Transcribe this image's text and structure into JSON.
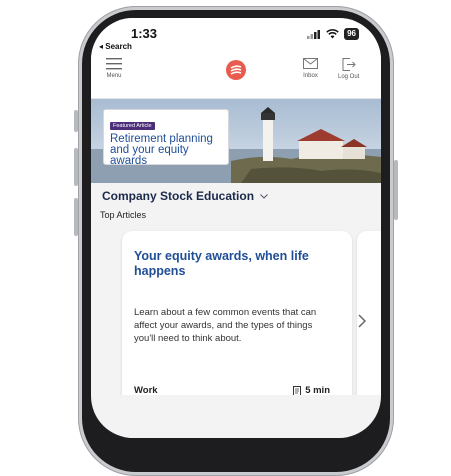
{
  "status_bar": {
    "time": "1:33",
    "back_label": "◂ Search",
    "battery": "96"
  },
  "header": {
    "menu_label": "Menu",
    "inbox_label": "Inbox",
    "logout_label": "Log Out"
  },
  "featured": {
    "badge": "Featured Article",
    "title": "Retirement planning and your equity awards"
  },
  "section": {
    "title": "Company Stock Education",
    "subtitle": "Top Articles"
  },
  "article": {
    "title": "Your equity awards, when life happens",
    "description": "Learn about a few common events that can affect your awards, and the types of things you'll need to think about.",
    "category": "Work",
    "read_time": "5 min"
  },
  "colors": {
    "accent": "#1f4e96",
    "logo": "#e85c4f",
    "badge": "#4b2d7a"
  },
  "icons": [
    "menu-icon",
    "logo-icon",
    "inbox-icon",
    "logout-icon",
    "signal-icon",
    "wifi-icon",
    "battery-icon",
    "chevron-down-icon",
    "document-icon",
    "chevron-right-icon"
  ]
}
